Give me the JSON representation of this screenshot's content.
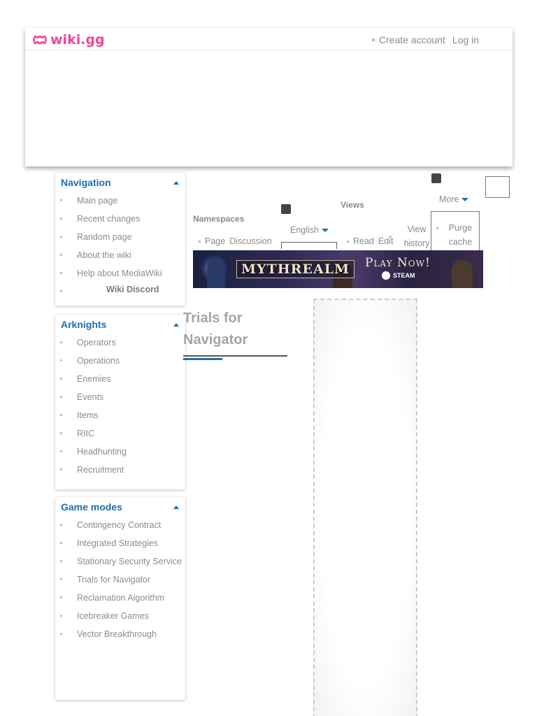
{
  "header": {
    "logo_text": "wiki.gg",
    "personal": [
      {
        "label": "Create account"
      },
      {
        "label": "Log in"
      }
    ]
  },
  "sidebar": {
    "navigation": {
      "title": "Navigation",
      "items": [
        "Main page",
        "Recent changes",
        "Random page",
        "About the wiki",
        "Help about MediaWiki",
        "Wiki Discord"
      ]
    },
    "arknights": {
      "title": "Arknights",
      "items": [
        "Operators",
        "Operations",
        "Enemies",
        "Events",
        "Items",
        "RIIC",
        "Headhunting",
        "Recruitment"
      ]
    },
    "game_modes": {
      "title": "Game modes",
      "items": [
        "Contingency Contract",
        "Integrated Strategies",
        "Stationary Security Service",
        "Trials for Navigator",
        "Reclamation Algorithm",
        "Icebreaker Games",
        "Vector Breakthrough"
      ]
    }
  },
  "namespaces": {
    "label": "Namespaces",
    "tabs": [
      "Page",
      "Discussion"
    ],
    "language": "English"
  },
  "views": {
    "label": "Views",
    "tabs": [
      "Read",
      "Edit",
      "View history"
    ],
    "more_label": "More",
    "more_items": [
      "Purge cache"
    ]
  },
  "banner": {
    "title": "MYTHREALM",
    "cta": "Play Now!",
    "platform": "STEAM"
  },
  "page": {
    "title": "Trials for Navigator"
  },
  "colors": {
    "brand": "#f0479a",
    "accent": "#1a6fb0"
  }
}
